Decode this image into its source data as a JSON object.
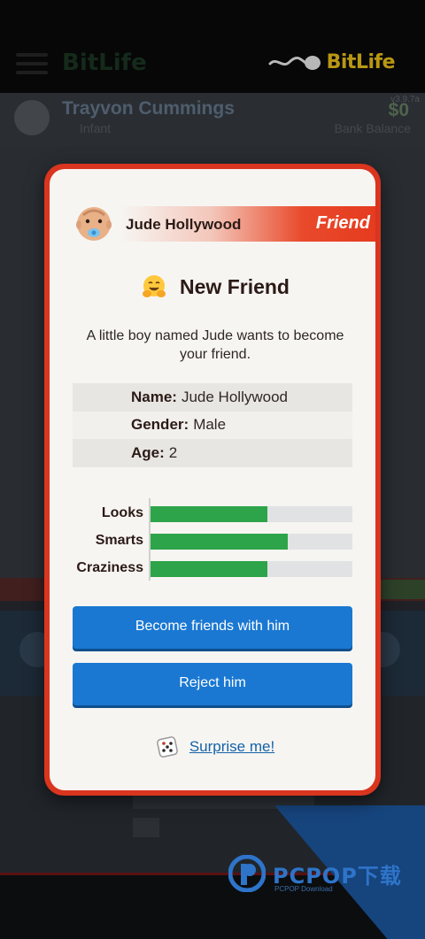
{
  "app": {
    "logo_text": "BitLife",
    "version": "v3.9.7a",
    "character_name": "Trayvon Cummings",
    "character_stage": "Infant",
    "bank_amount": "$0",
    "bank_label": "Bank Balance"
  },
  "dialog": {
    "person_name": "Jude Hollywood",
    "relation": "Friend",
    "title": "New Friend",
    "description": "A little boy named Jude wants to become your friend.",
    "info": [
      {
        "label": "Name:",
        "value": "Jude Hollywood"
      },
      {
        "label": "Gender:",
        "value": "Male"
      },
      {
        "label": "Age:",
        "value": "2"
      }
    ],
    "stats": [
      {
        "label": "Looks",
        "percent": 58
      },
      {
        "label": "Smarts",
        "percent": 68
      },
      {
        "label": "Craziness",
        "percent": 58
      }
    ],
    "accept_label": "Become friends with him",
    "reject_label": "Reject him",
    "surprise_label": "Surprise me!",
    "icons": {
      "avatar": "baby-with-pacifier-icon",
      "title": "hugging-face-icon",
      "surprise": "dice-icon"
    }
  },
  "colors": {
    "frame": "#d9351f",
    "button": "#1a78d2",
    "bar_fill": "#2ea44a",
    "logo": "#ffd21a"
  },
  "watermark": {
    "brand": "PCPOP下载",
    "sub": "PCPOP Download"
  }
}
